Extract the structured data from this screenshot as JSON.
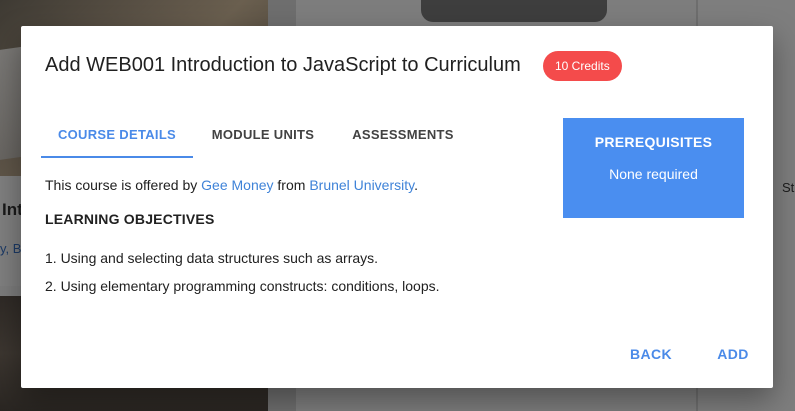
{
  "background": {
    "card_title": "Int",
    "card_links": "y, B",
    "right_text": "St"
  },
  "dialog": {
    "title": "Add WEB001 Introduction to JavaScript to Curriculum",
    "credits_badge": "10 Credits",
    "tabs": [
      {
        "label": "COURSE DETAILS",
        "active": true
      },
      {
        "label": "MODULE UNITS",
        "active": false
      },
      {
        "label": "ASSESSMENTS",
        "active": false
      }
    ],
    "course_details": {
      "offered_prefix": "This course is offered by ",
      "lecturer": "Gee Money",
      "offered_middle": " from ",
      "university": "Brunel University",
      "offered_suffix": ".",
      "objectives_heading": "LEARNING OBJECTIVES",
      "objectives": [
        "1. Using and selecting data structures such as arrays.",
        "2. Using elementary programming constructs: conditions, loops."
      ]
    },
    "prerequisites": {
      "title": "PREREQUISITES",
      "value": "None required"
    },
    "actions": {
      "back_label": "BACK",
      "add_label": "ADD"
    }
  },
  "colors": {
    "accent": "#4a8ae8",
    "badge": "#f44b4b",
    "prereq_bg": "#4a8ef0",
    "link": "#3f83d8"
  }
}
